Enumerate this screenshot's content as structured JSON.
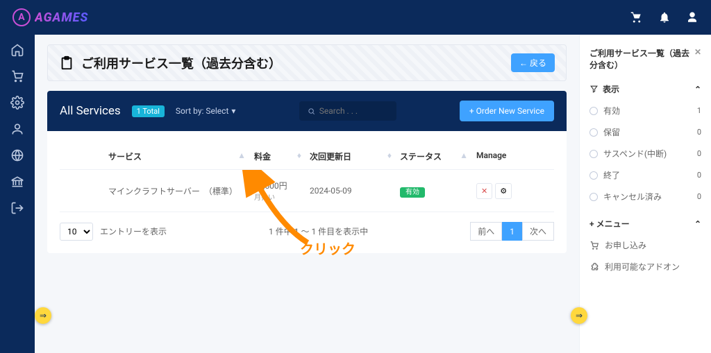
{
  "brand": "AGAMES",
  "header": {
    "title": "ご利用サービス一覧（過去分含む）",
    "back": "← 戻る"
  },
  "bar": {
    "title": "All Services",
    "total": "1 Total",
    "sortby": "Sort by: Select",
    "search_ph": "Search . . .",
    "order": "+ Order New Service"
  },
  "table": {
    "cols": {
      "service": "サービス",
      "price": "料金",
      "date": "次回更新日",
      "status": "ステータス",
      "manage": "Manage"
    },
    "row": {
      "service": "マインクラフトサーバー　（標準）",
      "price": "¥2,500円",
      "cycle": "月払い",
      "date": "2024-05-09",
      "status": "有効"
    },
    "entries_value": "10",
    "entries_label": "エントリーを表示",
    "info": "1 件中 1 〜 1 件目を表示中",
    "prev": "前へ",
    "page": "1",
    "next": "次へ"
  },
  "rp": {
    "title": "ご利用サービス一覧（過去分含む）",
    "display": "表示",
    "filters": [
      {
        "label": "有効",
        "count": "1"
      },
      {
        "label": "保留",
        "count": "0"
      },
      {
        "label": "サスペンド(中断)",
        "count": "0"
      },
      {
        "label": "終了",
        "count": "0"
      },
      {
        "label": "キャンセル済み",
        "count": "0"
      }
    ],
    "menu_label": "+ メニュー",
    "menu": [
      "お申し込み",
      "利用可能なアドオン"
    ]
  },
  "annotation": "クリック"
}
